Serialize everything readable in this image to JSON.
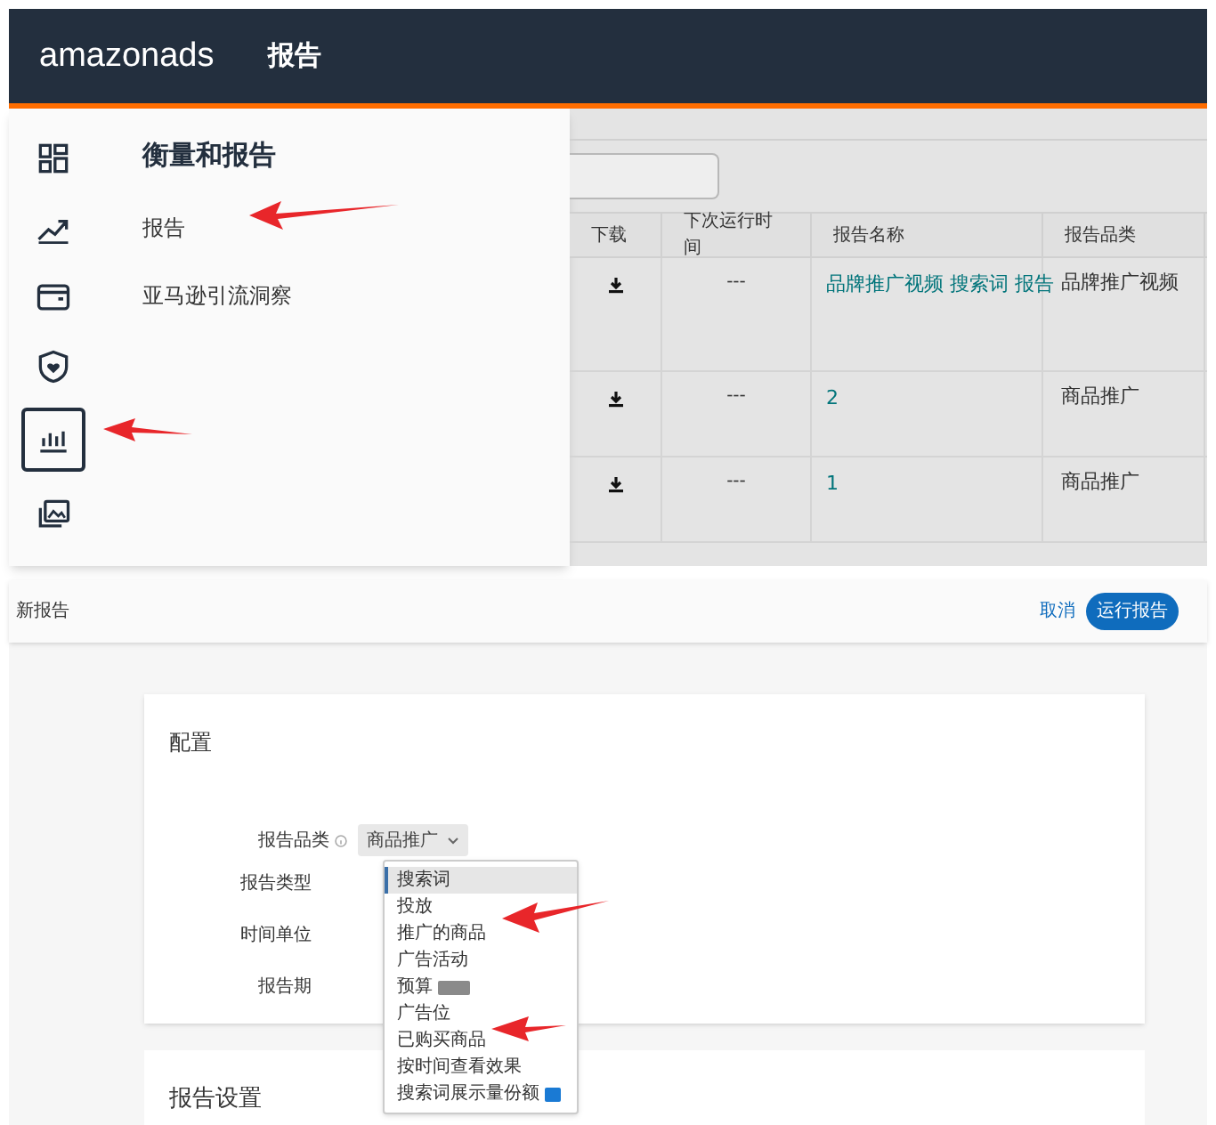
{
  "header": {
    "logo_main": "amazon",
    "logo_sub": "ads",
    "title": "报告"
  },
  "nav_rail": [
    {
      "kind": "grid",
      "selected": false
    },
    {
      "kind": "trend",
      "selected": false
    },
    {
      "kind": "wallet",
      "selected": false
    },
    {
      "kind": "shield",
      "selected": false
    },
    {
      "kind": "chart",
      "selected": true
    },
    {
      "kind": "images",
      "selected": false
    }
  ],
  "menu": {
    "title": "衡量和报告",
    "items": [
      "报告",
      "亚马逊引流洞察"
    ]
  },
  "table": {
    "columns": [
      "下载",
      "下次运行时间",
      "报告名称",
      "报告品类"
    ],
    "rows": [
      {
        "next_run": "---",
        "name": "品牌推广视频 搜索词 报告",
        "category": "品牌推广视频"
      },
      {
        "next_run": "---",
        "name": "2",
        "category": "商品推广"
      },
      {
        "next_run": "---",
        "name": "1",
        "category": "商品推广"
      }
    ]
  },
  "new_report": {
    "title": "新报告",
    "cancel": "取消",
    "run": "运行报告",
    "config": {
      "title": "配置",
      "fields": [
        {
          "label": "报告品类",
          "info": true,
          "value": "商品推广"
        },
        {
          "label": "报告类型"
        },
        {
          "label": "时间单位"
        },
        {
          "label": "报告期"
        }
      ],
      "options": [
        {
          "label": "搜索词",
          "selected": true
        },
        {
          "label": "投放",
          "selected": false
        },
        {
          "label": "推广的商品",
          "selected": false
        },
        {
          "label": "广告活动",
          "selected": false
        },
        {
          "label": "预算",
          "selected": false,
          "color": "#8a8a8a"
        },
        {
          "label": "广告位",
          "selected": false
        },
        {
          "label": "已购买商品",
          "selected": false
        },
        {
          "label": "按时间查看效果",
          "selected": false
        },
        {
          "label": "搜索词展示量份额",
          "selected": false,
          "color": "#1a7ad4"
        }
      ]
    },
    "settings_title": "报告设置"
  }
}
